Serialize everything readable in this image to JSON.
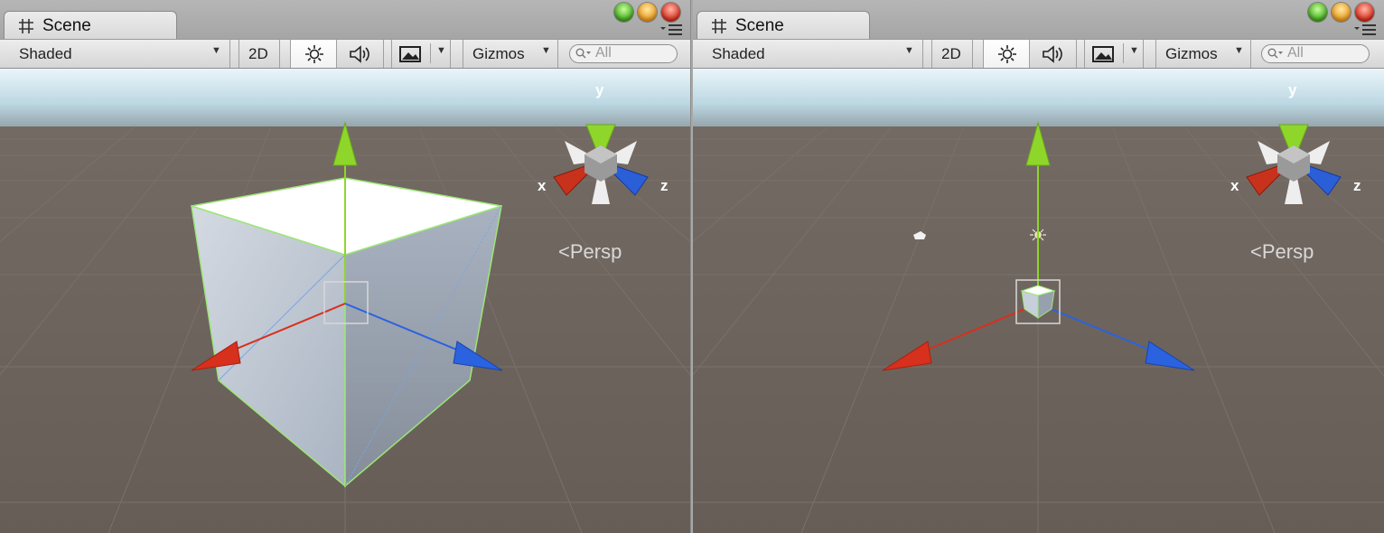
{
  "panels": [
    {
      "tab": {
        "title": "Scene",
        "icon": "scene-grid-icon"
      },
      "window_controls": [
        "green",
        "yellow",
        "red"
      ],
      "toolbar": {
        "draw_mode": "Shaded",
        "mode_2d": "2D",
        "lighting_icon": "sun-icon",
        "audio_icon": "speaker-icon",
        "effects_icon": "image-icon",
        "gizmos": "Gizmos",
        "search_placeholder": "All"
      },
      "gizmo": {
        "x": "x",
        "y": "y",
        "z": "z",
        "projection": "Persp"
      }
    },
    {
      "tab": {
        "title": "Scene",
        "icon": "scene-grid-icon"
      },
      "window_controls": [
        "green",
        "yellow",
        "red"
      ],
      "toolbar": {
        "draw_mode": "Shaded",
        "mode_2d": "2D",
        "lighting_icon": "sun-icon",
        "audio_icon": "speaker-icon",
        "effects_icon": "image-icon",
        "gizmos": "Gizmos",
        "search_placeholder": "All"
      },
      "gizmo": {
        "x": "x",
        "y": "y",
        "z": "z",
        "projection": "Persp"
      }
    }
  ],
  "colors": {
    "sky": "#cfe6ef",
    "ground": "#6b625c",
    "axis_x": "#d7301d",
    "axis_y": "#8fd62a",
    "axis_z": "#2a62e0",
    "selection": "#9ce676"
  }
}
